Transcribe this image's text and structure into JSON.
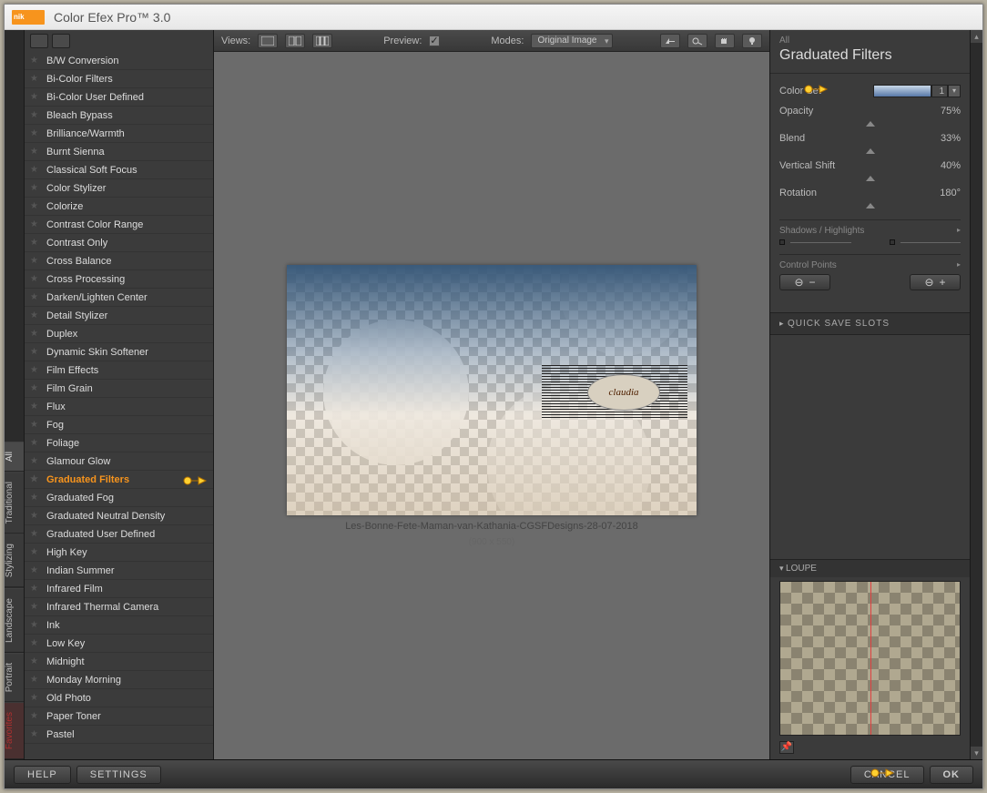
{
  "title": "Color Efex Pro™ 3.0",
  "logo_text": "nik",
  "toolbar": {
    "views_label": "Views:",
    "preview_label": "Preview:",
    "modes_label": "Modes:",
    "mode_value": "Original Image"
  },
  "vtabs": [
    "All",
    "Traditional",
    "Stylizing",
    "Landscape",
    "Portrait",
    "Favorites"
  ],
  "filters": [
    "B/W Conversion",
    "Bi-Color Filters",
    "Bi-Color User Defined",
    "Bleach Bypass",
    "Brilliance/Warmth",
    "Burnt Sienna",
    "Classical Soft Focus",
    "Color Stylizer",
    "Colorize",
    "Contrast Color Range",
    "Contrast Only",
    "Cross Balance",
    "Cross Processing",
    "Darken/Lighten Center",
    "Detail Stylizer",
    "Duplex",
    "Dynamic Skin Softener",
    "Film Effects",
    "Film Grain",
    "Flux",
    "Fog",
    "Foliage",
    "Glamour Glow",
    "Graduated Filters",
    "Graduated Fog",
    "Graduated Neutral Density",
    "Graduated User Defined",
    "High Key",
    "Indian Summer",
    "Infrared Film",
    "Infrared Thermal Camera",
    "Ink",
    "Low Key",
    "Midnight",
    "Monday Morning",
    "Old Photo",
    "Paper Toner",
    "Pastel"
  ],
  "active_filter": "Graduated Filters",
  "image": {
    "caption": "Les-Bonne-Fete-Maman-van-Kathania-CGSFDesigns-28-07-2018",
    "dims": "(900 x 550)"
  },
  "rpanel": {
    "all": "All",
    "name": "Graduated Filters",
    "colorset_label": "Color Set",
    "colorset_val": "1",
    "params": [
      {
        "label": "Opacity",
        "value": "75%"
      },
      {
        "label": "Blend",
        "value": "33%"
      },
      {
        "label": "Vertical Shift",
        "value": "40%"
      },
      {
        "label": "Rotation",
        "value": "180°"
      }
    ],
    "shadows_label": "Shadows / Highlights",
    "cp_label": "Control Points",
    "qsave": "QUICK SAVE SLOTS",
    "loupe": "LOUPE"
  },
  "footer": {
    "help": "HELP",
    "settings": "SETTINGS",
    "cancel": "CANCEL",
    "ok": "OK"
  }
}
